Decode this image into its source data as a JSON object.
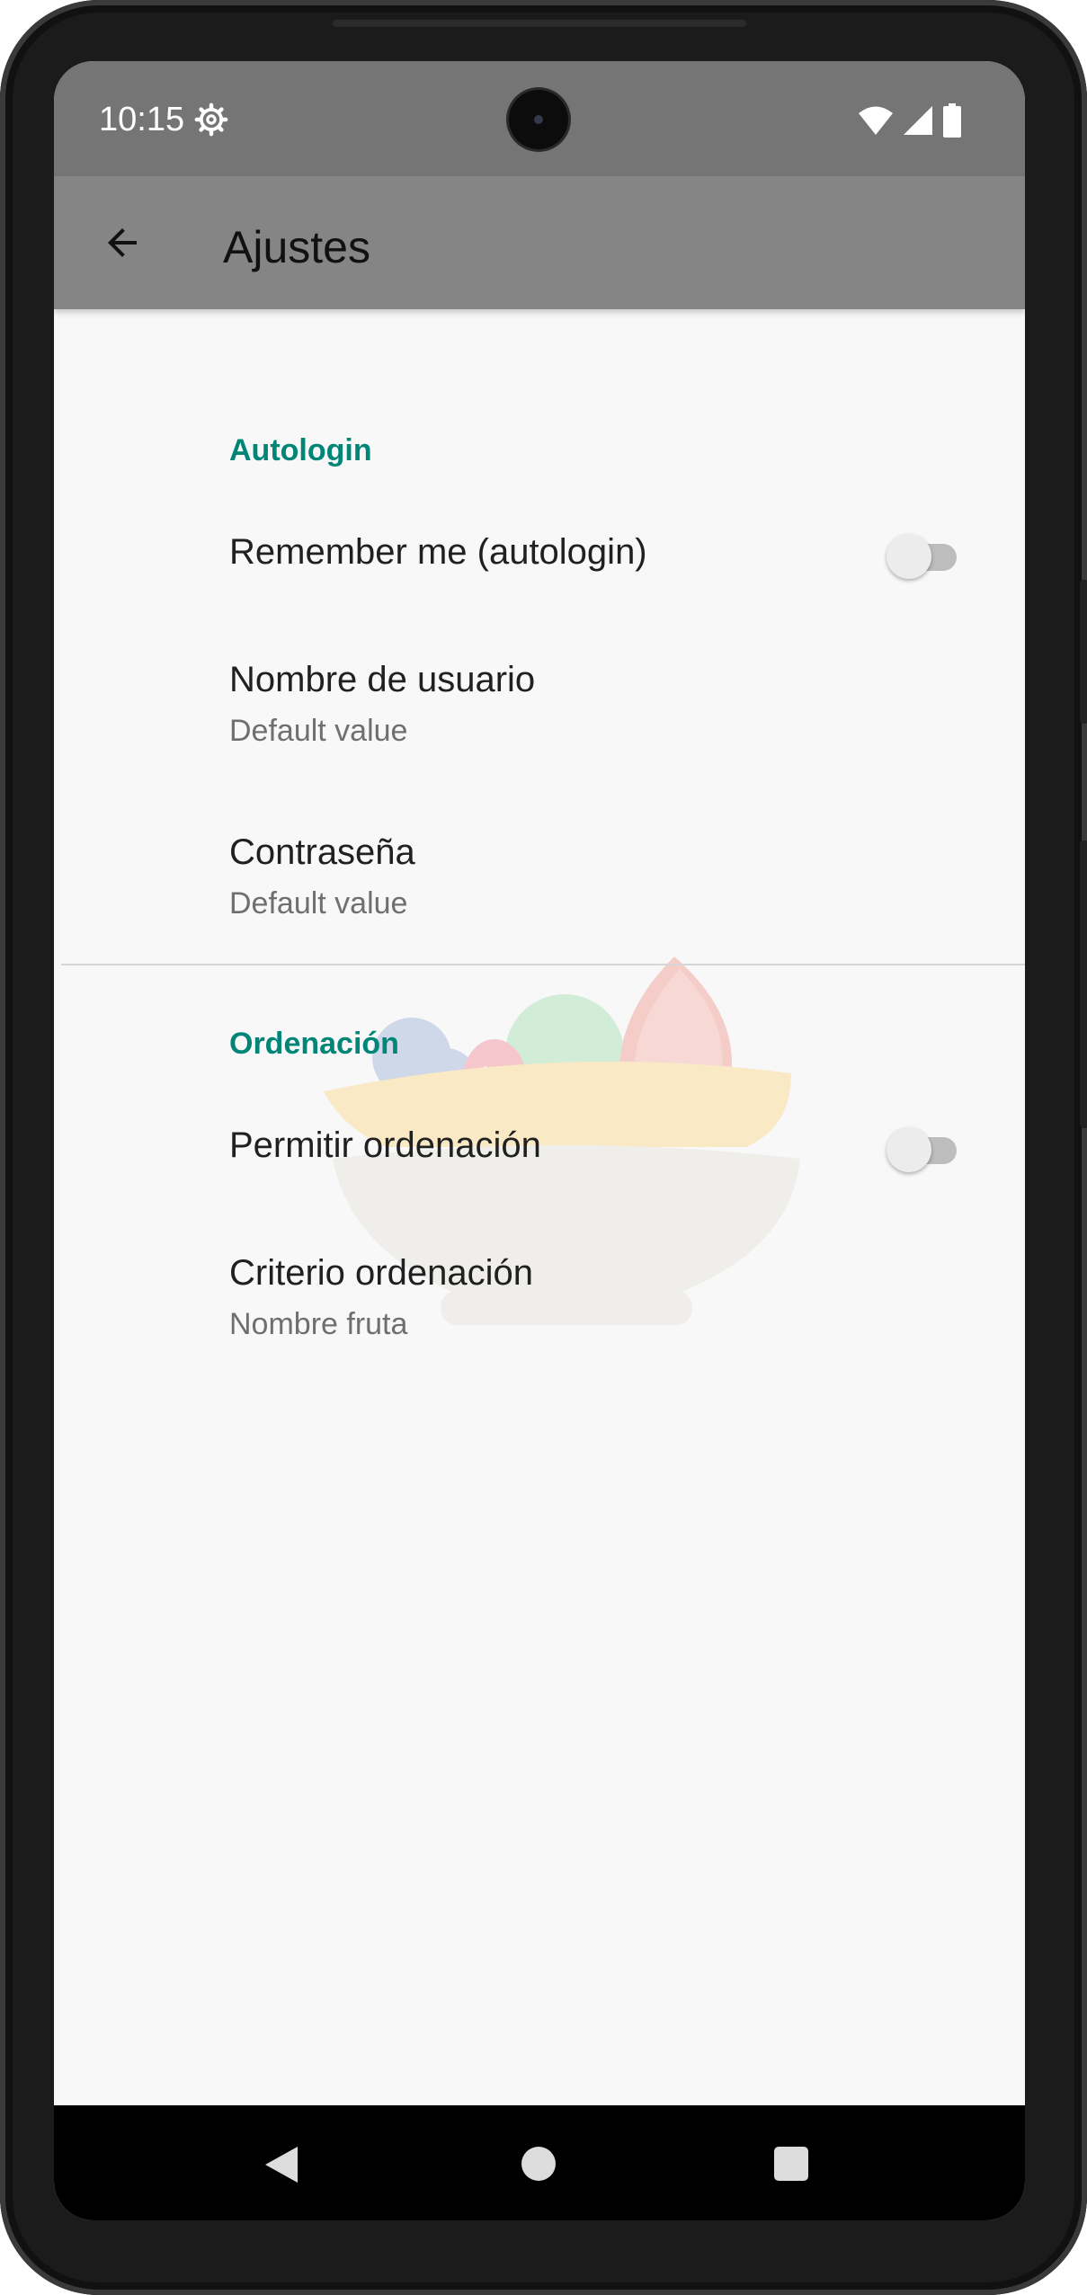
{
  "status_bar": {
    "time": "10:15",
    "icons": [
      "settings-gear-icon",
      "wifi-icon",
      "cell-signal-icon",
      "battery-icon"
    ]
  },
  "app_bar": {
    "title": "Ajustes",
    "back_icon": "arrow-back-icon"
  },
  "preferences": {
    "autologin_section": {
      "header": "Autologin",
      "remember_me": {
        "title": "Remember me (autologin)",
        "checked": false
      },
      "username": {
        "title": "Nombre de usuario",
        "summary": "Default value"
      },
      "password": {
        "title": "Contraseña",
        "summary": "Default value"
      }
    },
    "sorting_section": {
      "header": "Ordenación",
      "allow_sorting": {
        "title": "Permitir ordenación",
        "checked": false
      },
      "criterion": {
        "title": "Criterio ordenación",
        "summary": "Nombre fruta"
      }
    }
  },
  "watermark_icon": "fruit-bowl-icon",
  "navigation": {
    "back": "nav-back-icon",
    "home": "nav-home-icon",
    "recents": "nav-recents-icon"
  },
  "colors": {
    "accent": "#008577",
    "status_bar": "#757575",
    "app_bar": "#858585",
    "background": "#f8f8f8"
  }
}
